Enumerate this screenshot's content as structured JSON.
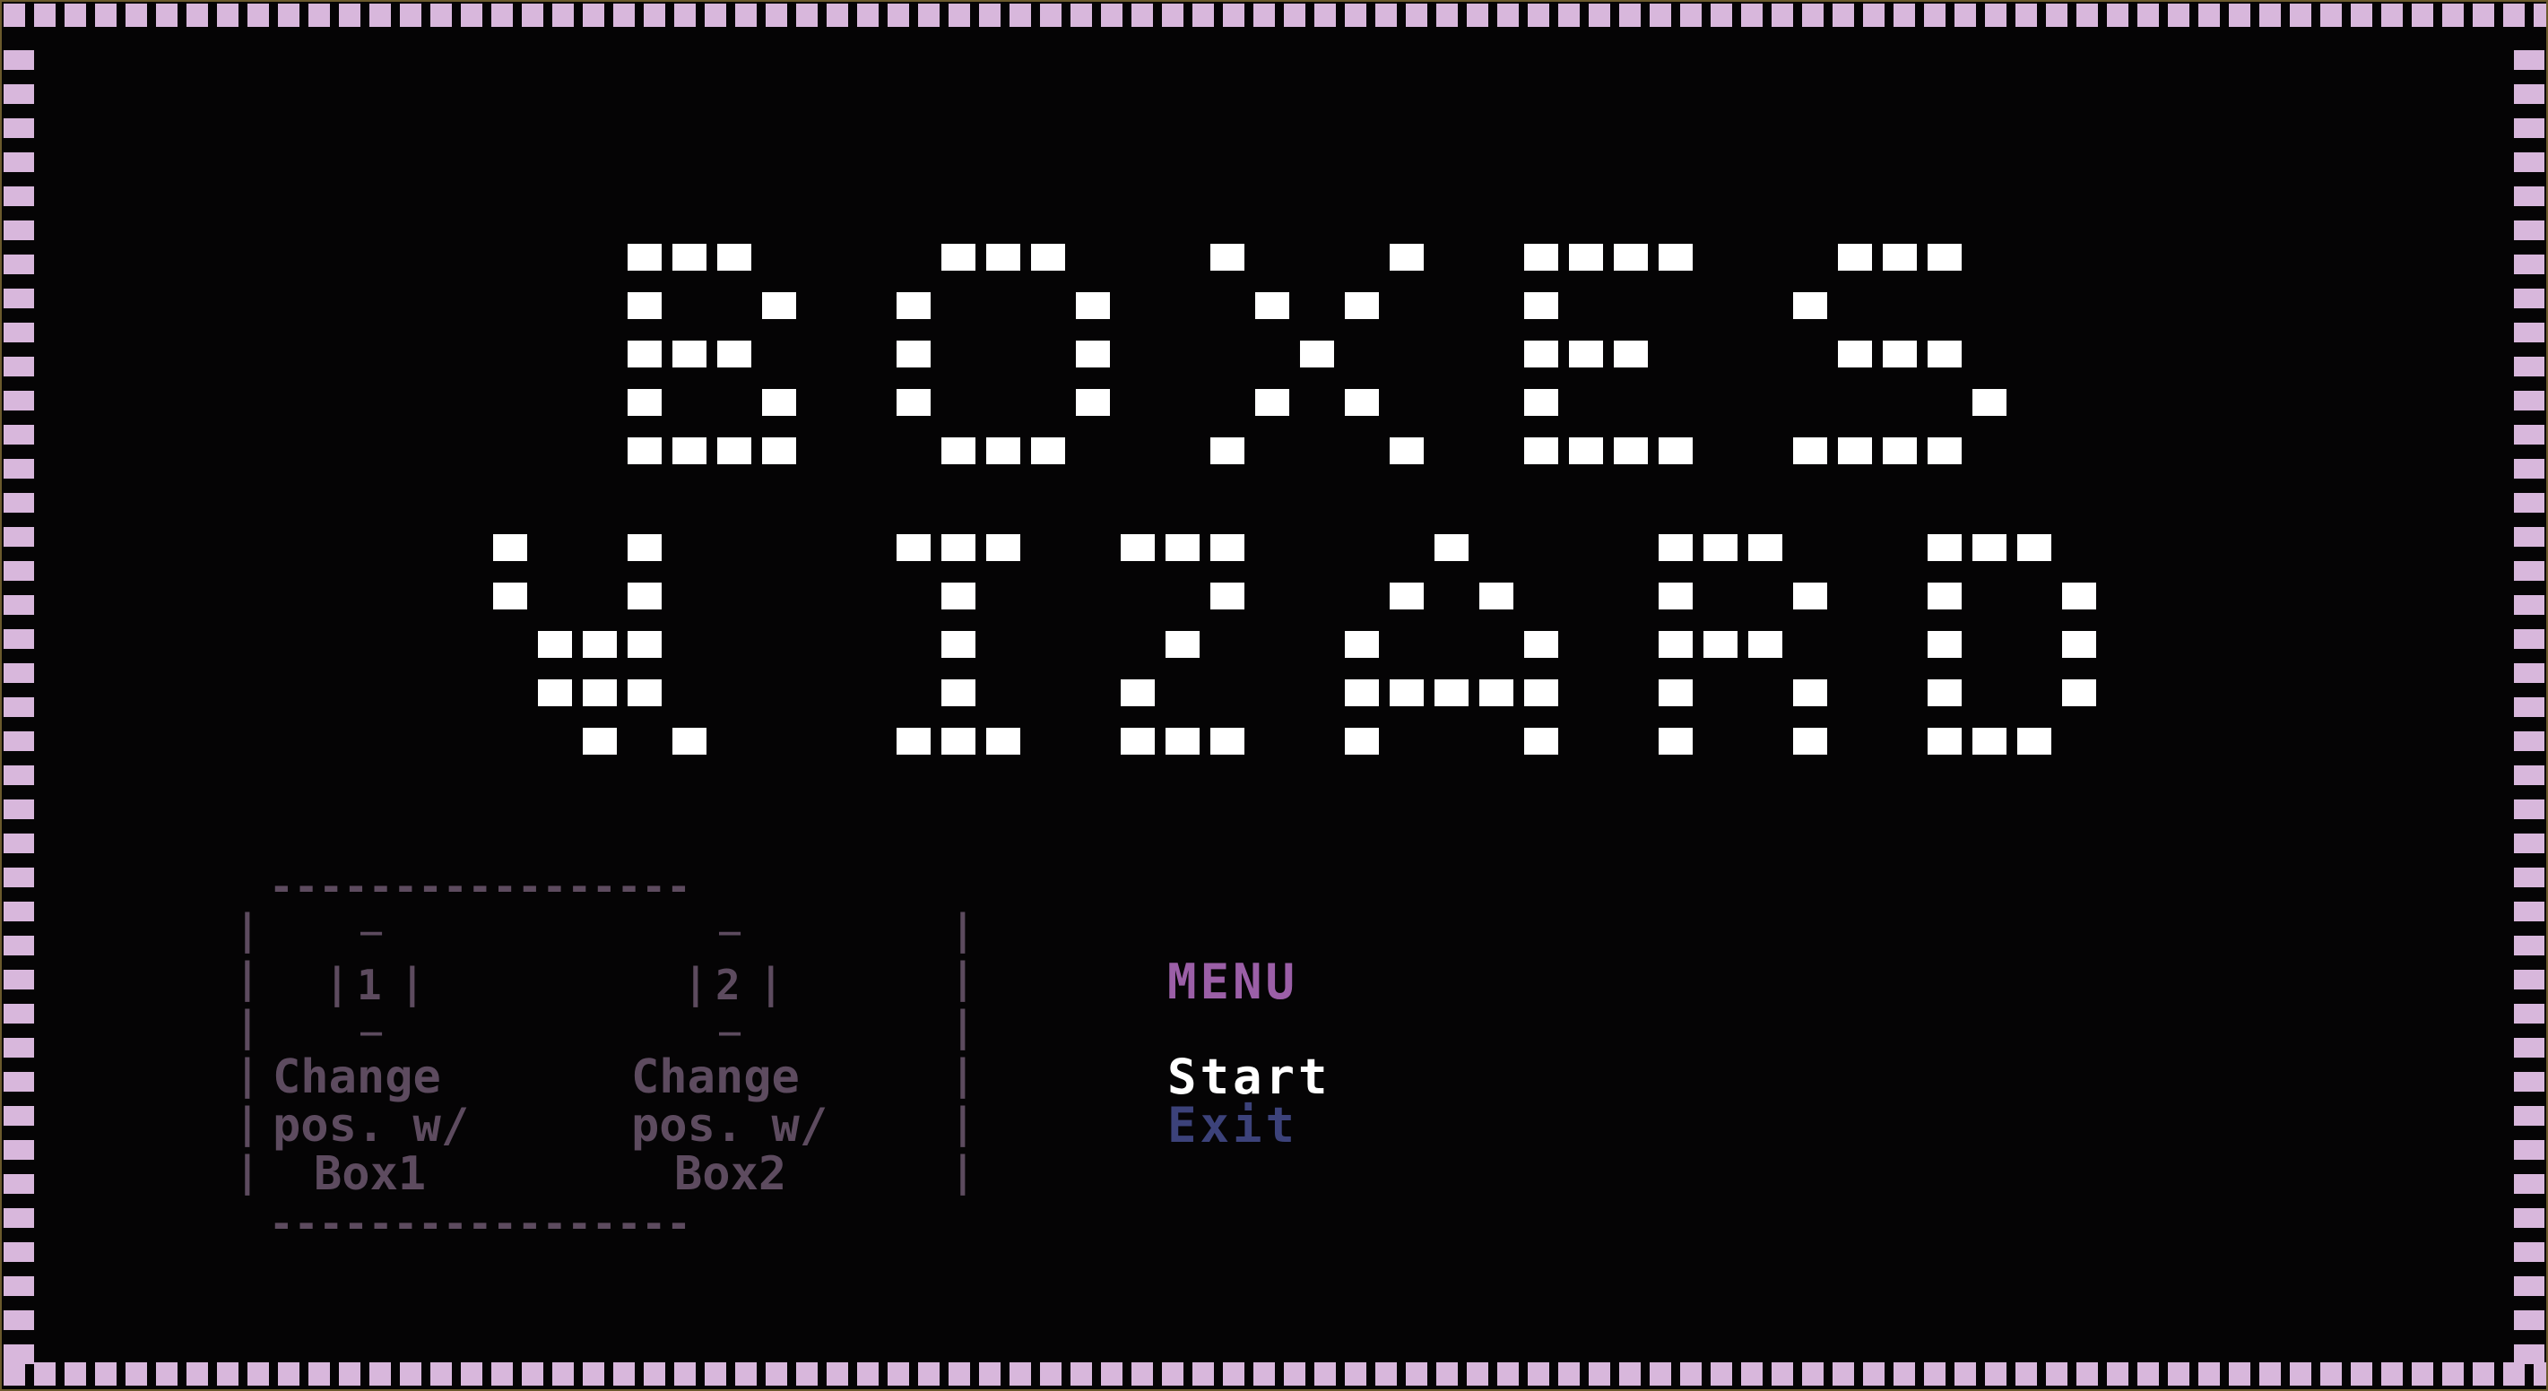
{
  "title": {
    "line1": "BOXES",
    "line2": "WIZARD"
  },
  "controls_panel": {
    "key1": "1",
    "key2": "2",
    "col1_lines": [
      "Change",
      "pos. w/",
      "Box1"
    ],
    "col2_lines": [
      "Change",
      "pos. w/",
      "Box2"
    ]
  },
  "menu": {
    "heading": "MENU",
    "items": [
      "Start",
      "Exit"
    ],
    "selected": "Start"
  },
  "colors": {
    "background": "#050405",
    "border": "#d8b7dc",
    "title_pixels": "#ffffff",
    "panel_text": "#5d4b5f",
    "menu_heading": "#9b5fa7",
    "menu_selected": "#ffffff",
    "menu_unselected": "#3c427a"
  }
}
